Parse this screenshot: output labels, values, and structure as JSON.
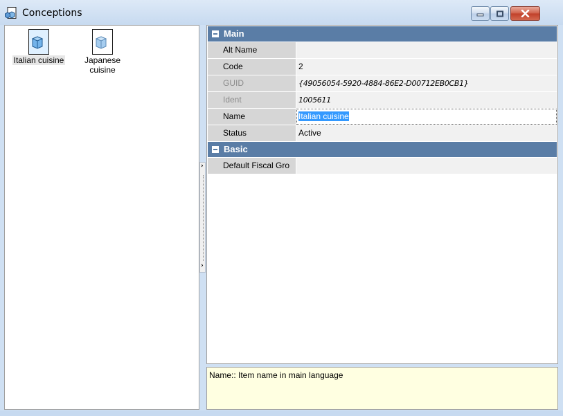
{
  "window": {
    "title": "Conceptions",
    "icon": "conception-icon"
  },
  "list": {
    "items": [
      {
        "label_line1": "Italian cuisine",
        "label_line2": "",
        "selected": true,
        "icon": "cube-icon"
      },
      {
        "label_line1": "Japanese",
        "label_line2": "cuisine",
        "selected": false,
        "icon": "cube-icon"
      }
    ]
  },
  "grid": {
    "sections": [
      {
        "title": "Main"
      },
      {
        "title": "Basic"
      }
    ],
    "main_rows": [
      {
        "name": "Alt Name",
        "value": ""
      },
      {
        "name": "Code",
        "value": "2"
      },
      {
        "name": "GUID",
        "value": "{49056054-5920-4884-86E2-D00712EB0CB1}"
      },
      {
        "name": "Ident",
        "value": "1005611"
      },
      {
        "name": "Name",
        "value": "Italian cuisine"
      },
      {
        "name": "Status",
        "value": "Active"
      }
    ],
    "basic_rows": [
      {
        "name": "Default Fiscal Gro",
        "value": ""
      }
    ]
  },
  "description": "Name:: Item name in main language",
  "colors": {
    "section_header": "#5a7da6",
    "selection": "#3399ff",
    "description_bg": "#ffffe1",
    "close_button": "#c0402a"
  }
}
